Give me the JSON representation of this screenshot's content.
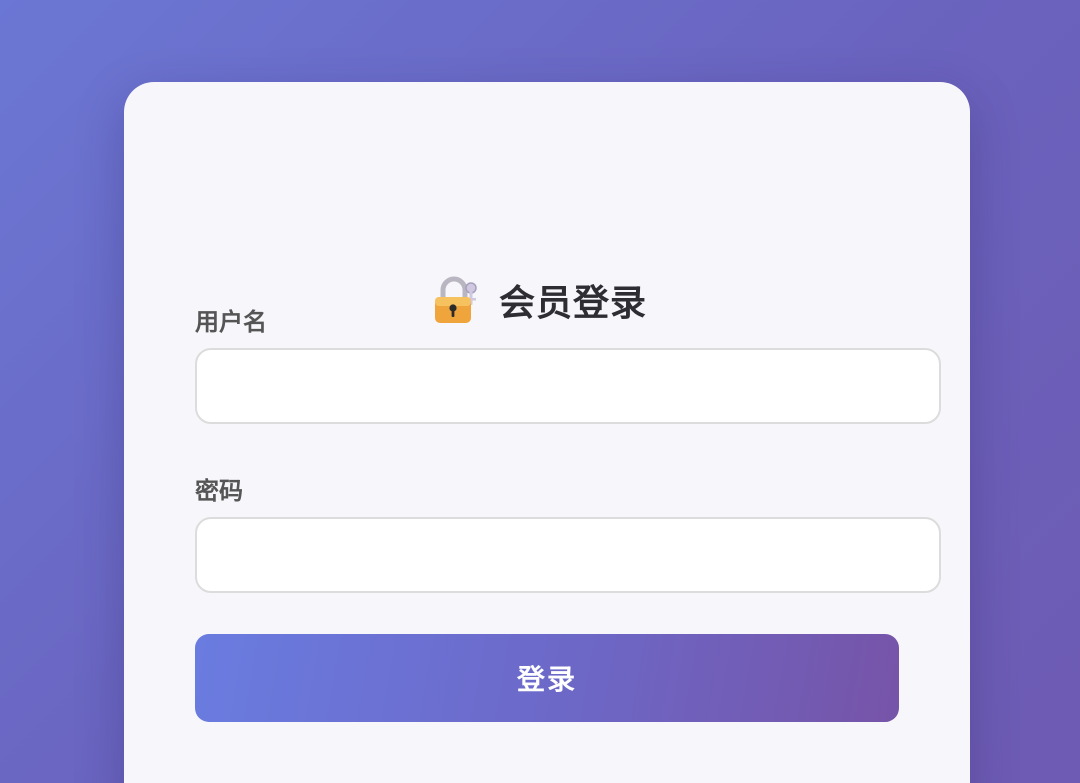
{
  "page": {
    "background_start": "#6b77d4",
    "background_end": "#6e5bb3"
  },
  "header": {
    "icon": "lock-with-key-icon",
    "title": "会员登录"
  },
  "form": {
    "username": {
      "label": "用户名",
      "value": "",
      "placeholder": ""
    },
    "password": {
      "label": "密码",
      "value": "",
      "placeholder": ""
    },
    "submit_label": "登录",
    "button_gradient_start": "#6a7ce0",
    "button_gradient_end": "#7654a8"
  }
}
